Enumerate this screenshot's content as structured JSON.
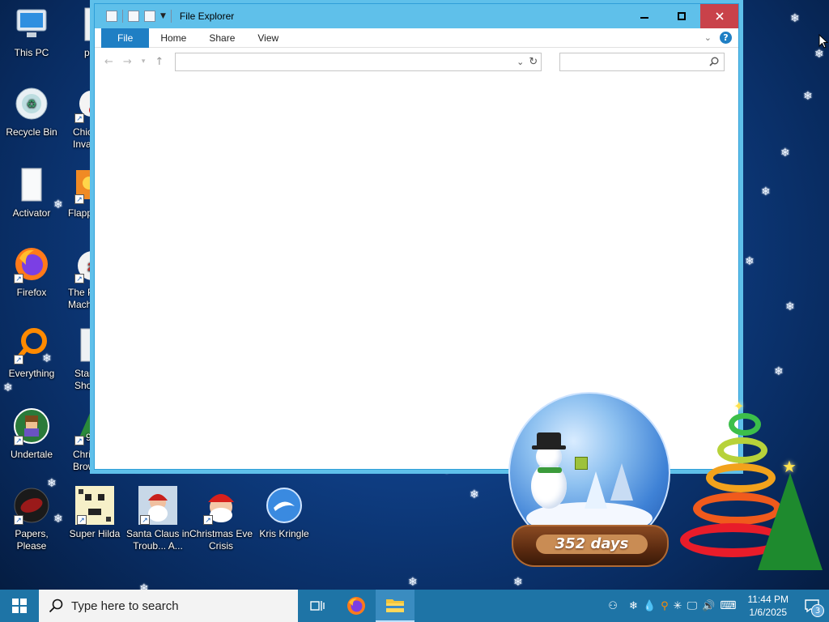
{
  "desktop": {
    "icons": [
      {
        "label": "This PC",
        "icon": "computer-icon"
      },
      {
        "label": "pop",
        "icon": "folder-icon"
      },
      {
        "label": "Recycle Bin",
        "icon": "recycle-bin-icon"
      },
      {
        "label": "Chic\nInvac",
        "icon": "chicken-invaders-icon"
      },
      {
        "label": "Activator",
        "icon": "folder-icon"
      },
      {
        "label": "Flappy",
        "icon": "flappy-icon"
      },
      {
        "label": "Firefox",
        "icon": "firefox-icon"
      },
      {
        "label": "The Po\nMachi",
        "icon": "pinball-machine-icon"
      },
      {
        "label": "Everything",
        "icon": "everything-search-icon"
      },
      {
        "label": "Start\nShop",
        "icon": "folder-icon"
      },
      {
        "label": "Undertale",
        "icon": "undertale-icon"
      },
      {
        "label": "Chris\nBrow",
        "icon": "christmas-browser-icon"
      },
      {
        "label": "Papers, Please",
        "icon": "papers-please-icon"
      },
      {
        "label": "Super Hilda",
        "icon": "super-hilda-icon"
      },
      {
        "label": "Santa Claus in\nTroub... A...",
        "icon": "santa-claus-icon"
      },
      {
        "label": "Christmas Eve\nCrisis",
        "icon": "christmas-eve-crisis-icon"
      },
      {
        "label": "Kris Kringle",
        "icon": "kris-kringle-icon"
      }
    ]
  },
  "explorer": {
    "title": "File Explorer",
    "tabs": {
      "file": "File",
      "home": "Home",
      "share": "Share",
      "view": "View"
    },
    "help": "?",
    "address_value": "",
    "search_placeholder": ""
  },
  "widget": {
    "days": "352 days"
  },
  "taskbar": {
    "search_placeholder": "Type here to search",
    "time": "11:44 PM",
    "date": "1/6/2025",
    "notification_count": "3"
  },
  "colors": {
    "taskbar": "#1e74a6",
    "window_frame": "#5fc0ea",
    "close_button": "#c9424a",
    "file_tab": "#1f7fc4"
  }
}
